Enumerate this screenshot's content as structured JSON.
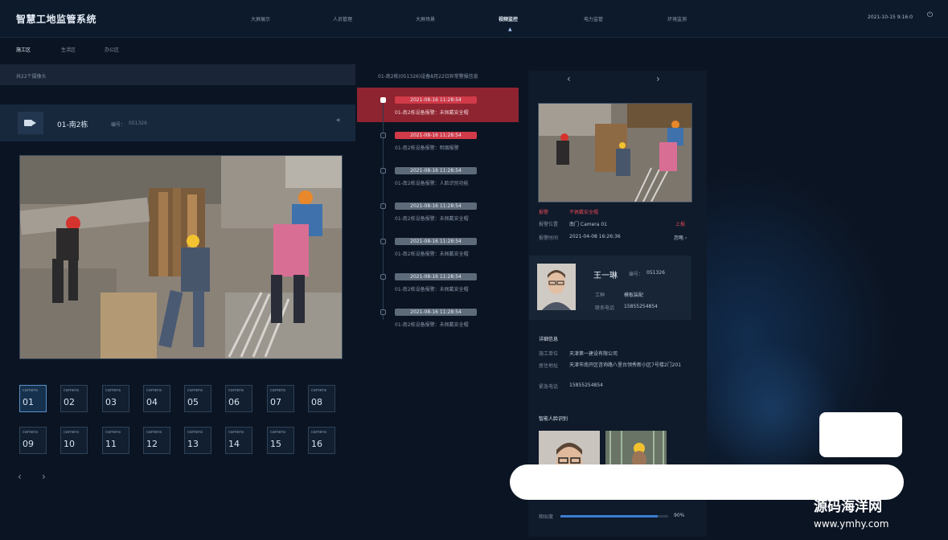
{
  "header": {
    "title": "智慧工地监管系统",
    "nav": [
      "大屏展示",
      "人员管理",
      "大屏场景",
      "视频监控",
      "电力监管",
      "环境监测"
    ],
    "active_nav": "视频监控",
    "datetime": "2021-10-15 9:16:0"
  },
  "subtabs": {
    "items": [
      "施工区",
      "生活区",
      "办公区"
    ],
    "active": "施工区"
  },
  "left": {
    "camera_count_text": "共22个摄像头",
    "camera_name": "01-南2栋",
    "camera_code_label": "编号：",
    "camera_code_value": "051326",
    "camera_label": "camera",
    "cameras": [
      "01",
      "02",
      "03",
      "04",
      "05",
      "06",
      "07",
      "08",
      "09",
      "10",
      "11",
      "12",
      "13",
      "14",
      "15",
      "16"
    ],
    "active_camera": "01"
  },
  "timeline": {
    "title": "01-南2栋(051326)设备8月22日异常警报信息",
    "alerts": [
      {
        "time": "2021-08-16  11:28:54",
        "desc": "01-南2栋设备报警：未佩戴安全帽",
        "status": "red",
        "selected": true
      },
      {
        "time": "2021-08-16  11:28:54",
        "desc": "01-南2栋设备报警：明烟报警",
        "status": "red",
        "selected": false
      },
      {
        "time": "2021-08-16  11:28:54",
        "desc": "01-南2栋设备报警：人脸识别功能",
        "status": "grey",
        "selected": false
      },
      {
        "time": "2021-08-16  11:28:54",
        "desc": "01-南2栋设备报警：未佩戴安全帽",
        "status": "grey",
        "selected": false
      },
      {
        "time": "2021-08-16  11:28:54",
        "desc": "01-南2栋设备报警：未佩戴安全帽",
        "status": "grey",
        "selected": false
      },
      {
        "time": "2021-08-16  11:28:54",
        "desc": "01-南2栋设备报警：未佩戴安全帽",
        "status": "grey",
        "selected": false
      },
      {
        "time": "2021-08-16  11:28:54",
        "desc": "01-南2栋设备报警：未佩戴安全帽",
        "status": "grey",
        "selected": false
      }
    ]
  },
  "detail": {
    "alarm_label": "报警",
    "alarm_value": "不佩戴安全帽",
    "location_label": "报警位置",
    "location_value": "南门 Camera 01",
    "location_badge": "上报",
    "time_label": "报警时间",
    "time_value": "2021-04-08  16:26:36",
    "time_link": "忽略 ›",
    "person": {
      "name": "王一琳",
      "code_label": "编号：",
      "code_value": "051326",
      "job_label": "工种",
      "job_value": "模板装配",
      "phone_label": "联系电话",
      "phone_value": "15855254854"
    },
    "info_title": "详细信息",
    "company_label": "施工单位",
    "company_value": "天津第一建设有限公司",
    "address_label": "居住地址",
    "address_value": "天津市南开区咨询路八里台领秀新小区7号楼2门201",
    "emergency_label": "紧急电话",
    "emergency_value": "15855254854",
    "face_title": "智能人脸识别",
    "similarity_label": "相似度",
    "similarity_value": "90%",
    "similarity": 0.9
  },
  "watermark": {
    "line1": "源码海洋网",
    "line2": "www.ymhy.com"
  },
  "colors": {
    "accent": "#3b7dd1",
    "alarm": "#d13a48",
    "selected_row": "#8e2430"
  }
}
